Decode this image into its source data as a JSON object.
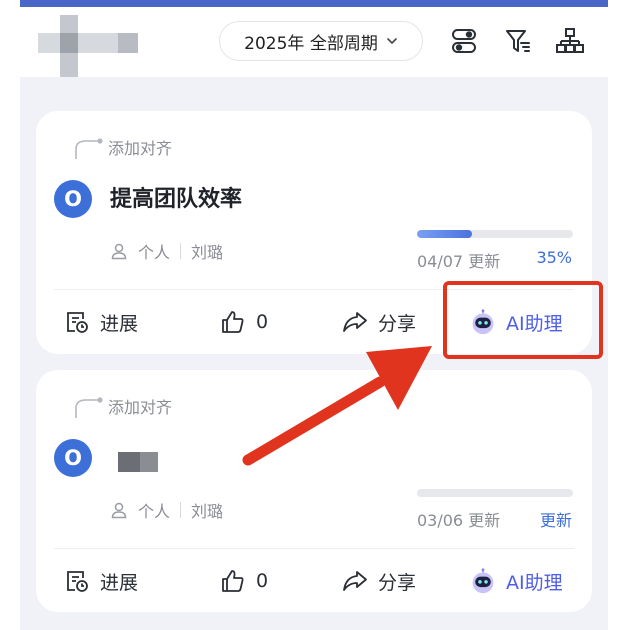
{
  "header": {
    "period_label": "2025年 全部周期",
    "icons": [
      "toggle-icon",
      "filter-icon",
      "org-chart-icon"
    ]
  },
  "cards": [
    {
      "align_label": "添加对齐",
      "badge": "O",
      "title": "提高团队效率",
      "scope": "个人",
      "owner": "刘璐",
      "progress_fraction": 0.35,
      "updated": "04/07 更新",
      "status": "35%",
      "actions": {
        "progress": "进展",
        "likes": "0",
        "share": "分享",
        "ai": "AI助理"
      }
    },
    {
      "align_label": "添加对齐",
      "badge": "O",
      "title": "",
      "scope": "个人",
      "owner": "刘璐",
      "progress_fraction": 0,
      "updated": "03/06 更新",
      "status": "更新",
      "actions": {
        "progress": "进展",
        "likes": "0",
        "share": "分享",
        "ai": "AI助理"
      }
    }
  ],
  "colors": {
    "accent": "#3c6fd8",
    "ai": "#4d5ee8",
    "annotation": "#e0341f"
  }
}
